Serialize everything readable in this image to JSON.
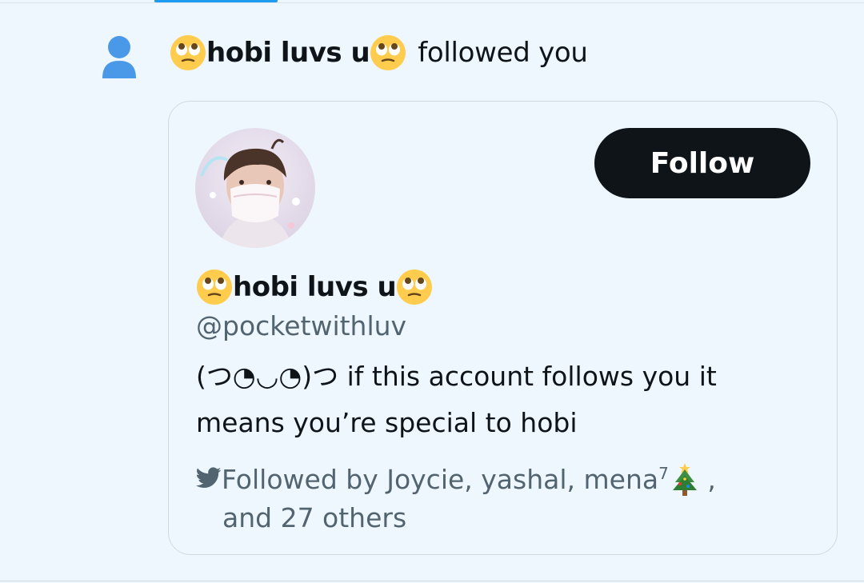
{
  "notification": {
    "icon": "person-icon",
    "user_name": "hobi luvs u",
    "action": "followed you",
    "name_emoji": "face-with-rolling-eyes-emoji"
  },
  "card": {
    "avatar_alt": "profile photo",
    "follow_label": "Follow",
    "display_name": "hobi luvs u",
    "handle": "@pocketwithluv",
    "bio_line1": "(つ◔◡◔)つ if this account follows you it",
    "bio_line2": "means you’re special to hobi",
    "followed_by_prefix": "Followed by Joycie, yashal, mena",
    "followed_by_sup": "7",
    "followed_by_after_emoji": " ,",
    "followed_by_line2": "and 27 others"
  },
  "colors": {
    "background": "#eef7fd",
    "accent": "#1d9bf0",
    "follow_button": "#0f1419",
    "secondary_text": "#536471"
  },
  "icons": {
    "bird": "twitter-bird-icon",
    "tree": "christmas-tree-emoji"
  }
}
